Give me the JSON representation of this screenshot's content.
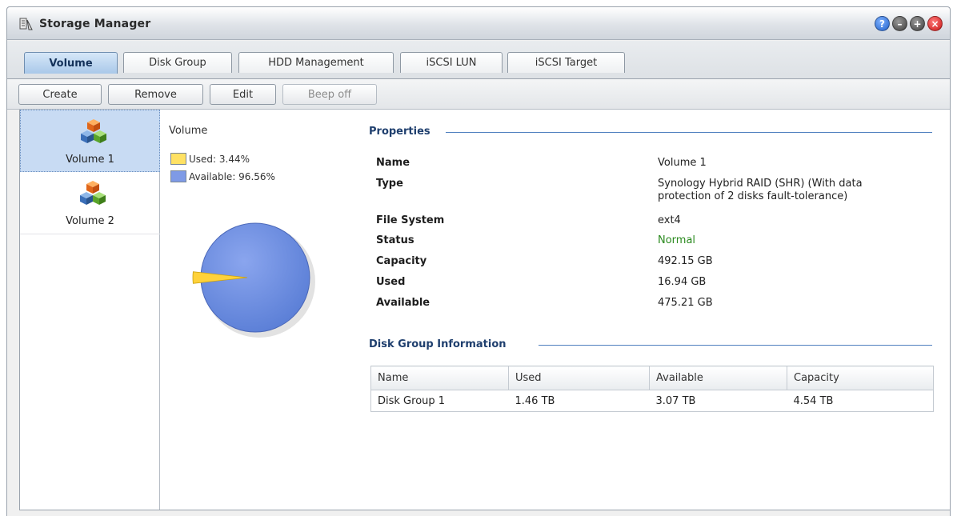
{
  "window": {
    "title": "Storage Manager",
    "buttons": {
      "help": "?",
      "minimize": "–",
      "maximize": "+",
      "close": "×"
    }
  },
  "tabs": [
    {
      "label": "Volume",
      "active": true
    },
    {
      "label": "Disk Group",
      "active": false
    },
    {
      "label": "HDD Management",
      "active": false
    },
    {
      "label": "iSCSI LUN",
      "active": false
    },
    {
      "label": "iSCSI Target",
      "active": false
    }
  ],
  "toolbar": {
    "create": "Create",
    "remove": "Remove",
    "edit": "Edit",
    "beep_off": "Beep off"
  },
  "volumes": [
    {
      "label": "Volume 1",
      "selected": true
    },
    {
      "label": "Volume 2",
      "selected": false
    }
  ],
  "usage": {
    "title": "Volume",
    "legend": [
      {
        "label": "Used: 3.44%",
        "color": "#ffe163"
      },
      {
        "label": "Available: 96.56%",
        "color": "#7e9ae6"
      }
    ],
    "used_percent": 3.44,
    "available_percent": 96.56
  },
  "properties": {
    "title": "Properties",
    "rows": [
      {
        "key": "Name",
        "value": "Volume 1"
      },
      {
        "key": "Type",
        "value": "Synology Hybrid RAID (SHR) (With data",
        "value2": "protection of 2 disks fault-tolerance)"
      },
      {
        "key": "File System",
        "value": "ext4"
      },
      {
        "key": "Status",
        "value": "Normal"
      },
      {
        "key": "Capacity",
        "value": "492.15 GB"
      },
      {
        "key": "Used",
        "value": "16.94 GB"
      },
      {
        "key": "Available",
        "value": "475.21 GB"
      }
    ]
  },
  "disk_group": {
    "title": "Disk Group Information",
    "columns": [
      "Name",
      "Used",
      "Available",
      "Capacity"
    ],
    "rows": [
      [
        "Disk Group 1",
        "1.46 TB",
        "3.07 TB",
        "4.54 TB"
      ]
    ]
  },
  "colors": {
    "accent": "#4f7fbf",
    "status_ok": "#2b8a1f",
    "pie_used": "#ffd23a",
    "pie_available": "#6c8de2"
  }
}
